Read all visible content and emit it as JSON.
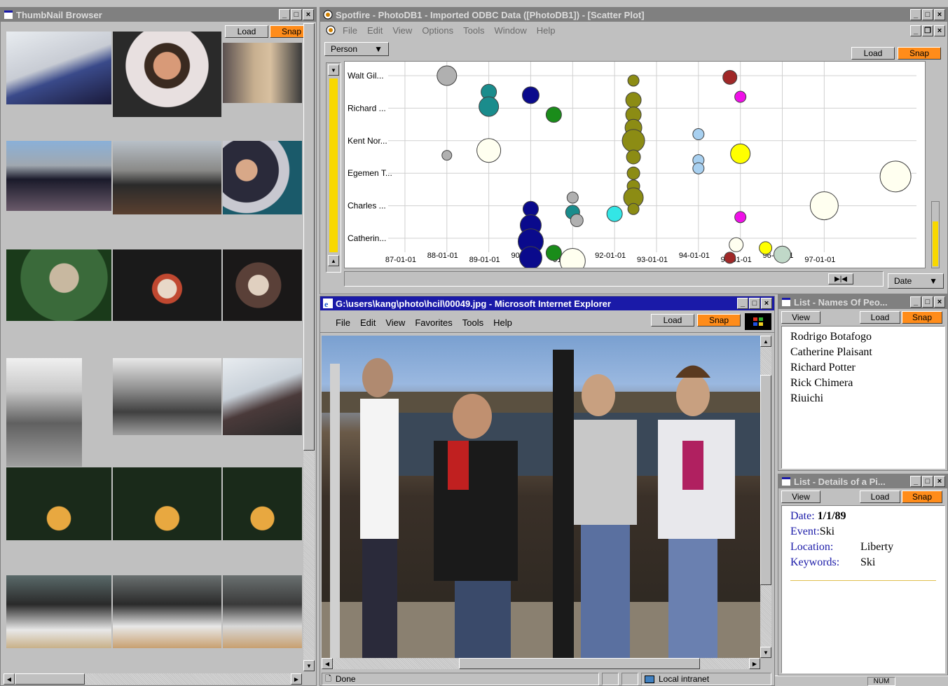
{
  "thumbnail_browser": {
    "title": "ThumbNail Browser",
    "load_label": "Load",
    "snap_label": "Snap"
  },
  "spotfire": {
    "title": "Spotfire - PhotoDB1 - Imported ODBC Data ([PhotoDB1]) - [Scatter Plot]",
    "menu": [
      "File",
      "Edit",
      "View",
      "Options",
      "Tools",
      "Window",
      "Help"
    ],
    "y_selector": "Person",
    "x_selector": "Date",
    "load_label": "Load",
    "snap_label": "Snap"
  },
  "chart_data": {
    "type": "scatter",
    "categories_y": [
      "Walt Gil...",
      "Richard ...",
      "Kent Nor...",
      "Egemen T...",
      "Charles ...",
      "Catherin..."
    ],
    "x_ticks": [
      "87-01-01",
      "88-01-01",
      "89-01-01",
      "90-01-01",
      "91-01-01",
      "92-01-01",
      "93-01-01",
      "94-01-01",
      "95-01-01",
      "96-01-01",
      "97-01-01"
    ],
    "points": [
      {
        "x": 1988.0,
        "y": 0,
        "r": 14,
        "color": "#b0b0b0"
      },
      {
        "x": 1988.0,
        "y": 2.45,
        "r": 7,
        "color": "#b0b0b0"
      },
      {
        "x": 1989.0,
        "y": 0.5,
        "r": 11,
        "color": "#1a8c8c"
      },
      {
        "x": 1989.0,
        "y": 0.95,
        "r": 14,
        "color": "#1a8c8c"
      },
      {
        "x": 1989.0,
        "y": 2.3,
        "r": 17,
        "color": "#fffff0"
      },
      {
        "x": 1990.0,
        "y": 0.6,
        "r": 12,
        "color": "#0a0a8c"
      },
      {
        "x": 1990.55,
        "y": 1.2,
        "r": 11,
        "color": "#1a8c1a"
      },
      {
        "x": 1990.0,
        "y": 4.1,
        "r": 11,
        "color": "#0a0a8c"
      },
      {
        "x": 1990.0,
        "y": 4.6,
        "r": 15,
        "color": "#0a0a8c"
      },
      {
        "x": 1990.0,
        "y": 5.1,
        "r": 18,
        "color": "#0a0a8c"
      },
      {
        "x": 1990.0,
        "y": 5.6,
        "r": 16,
        "color": "#0a0a8c"
      },
      {
        "x": 1990.55,
        "y": 5.45,
        "r": 11,
        "color": "#1a8c1a"
      },
      {
        "x": 1991.0,
        "y": 3.75,
        "r": 8,
        "color": "#b0b0b0"
      },
      {
        "x": 1991.0,
        "y": 4.2,
        "r": 10,
        "color": "#1a8c8c"
      },
      {
        "x": 1991.1,
        "y": 4.45,
        "r": 9,
        "color": "#b0b0b0"
      },
      {
        "x": 1991.0,
        "y": 5.7,
        "r": 18,
        "color": "#fffff0"
      },
      {
        "x": 1992.0,
        "y": 4.25,
        "r": 11,
        "color": "#33e6e6"
      },
      {
        "x": 1992.45,
        "y": 0.15,
        "r": 8,
        "color": "#8c8c14"
      },
      {
        "x": 1992.45,
        "y": 0.75,
        "r": 11,
        "color": "#8c8c14"
      },
      {
        "x": 1992.45,
        "y": 1.2,
        "r": 11,
        "color": "#8c8c14"
      },
      {
        "x": 1992.45,
        "y": 1.6,
        "r": 12,
        "color": "#8c8c14"
      },
      {
        "x": 1992.45,
        "y": 2.0,
        "r": 16,
        "color": "#8c8c14"
      },
      {
        "x": 1992.45,
        "y": 2.5,
        "r": 10,
        "color": "#8c8c14"
      },
      {
        "x": 1992.45,
        "y": 3.0,
        "r": 9,
        "color": "#8c8c14"
      },
      {
        "x": 1992.45,
        "y": 3.4,
        "r": 9,
        "color": "#8c8c14"
      },
      {
        "x": 1992.45,
        "y": 3.75,
        "r": 14,
        "color": "#8c8c14"
      },
      {
        "x": 1992.45,
        "y": 4.1,
        "r": 8,
        "color": "#8c8c14"
      },
      {
        "x": 1994.0,
        "y": 1.8,
        "r": 8,
        "color": "#a8d0f0"
      },
      {
        "x": 1994.0,
        "y": 2.6,
        "r": 8,
        "color": "#a8d0f0"
      },
      {
        "x": 1994.0,
        "y": 2.85,
        "r": 8,
        "color": "#a8d0f0"
      },
      {
        "x": 1994.75,
        "y": 0.05,
        "r": 10,
        "color": "#a02828"
      },
      {
        "x": 1995.0,
        "y": 0.65,
        "r": 8,
        "color": "#f010e8"
      },
      {
        "x": 1995.0,
        "y": 2.4,
        "r": 14,
        "color": "#ffff00"
      },
      {
        "x": 1995.0,
        "y": 4.35,
        "r": 8,
        "color": "#f010e8"
      },
      {
        "x": 1994.9,
        "y": 5.2,
        "r": 10,
        "color": "#fffff0"
      },
      {
        "x": 1994.75,
        "y": 5.6,
        "r": 8,
        "color": "#a02828"
      },
      {
        "x": 1995.6,
        "y": 5.3,
        "r": 9,
        "color": "#ffff00"
      },
      {
        "x": 1996.0,
        "y": 5.5,
        "r": 12,
        "color": "#c0d8c8"
      },
      {
        "x": 1997.0,
        "y": 4.0,
        "r": 20,
        "color": "#fffff0"
      },
      {
        "x": 1998.7,
        "y": 3.1,
        "r": 22,
        "color": "#fffff0"
      }
    ],
    "grid": true
  },
  "browser": {
    "title": "G:\\users\\kang\\photo\\hcil\\00049.jpg - Microsoft Internet Explorer",
    "menu": [
      "File",
      "Edit",
      "View",
      "Favorites",
      "Tools",
      "Help"
    ],
    "load_label": "Load",
    "snap_label": "Snap",
    "status_left": "Done",
    "status_zone": "Local intranet"
  },
  "names_list": {
    "title": "List - Names Of Peo...",
    "view_label": "View",
    "load_label": "Load",
    "snap_label": "Snap",
    "names": [
      "Rodrigo Botafogo",
      "Catherine Plaisant",
      "Richard Potter",
      "Rick Chimera",
      "Riuichi"
    ]
  },
  "details_list": {
    "title": "List - Details of a Pi...",
    "view_label": "View",
    "load_label": "Load",
    "snap_label": "Snap",
    "date_label": "Date:",
    "date_value": "1/1/89",
    "event_label": "Event:",
    "event_value": "Ski",
    "location_label": "Location:",
    "location_value": "Liberty",
    "keywords_label": "Keywords:",
    "keywords_value": "Ski"
  },
  "taskbar": {
    "num_label": "NUM"
  }
}
